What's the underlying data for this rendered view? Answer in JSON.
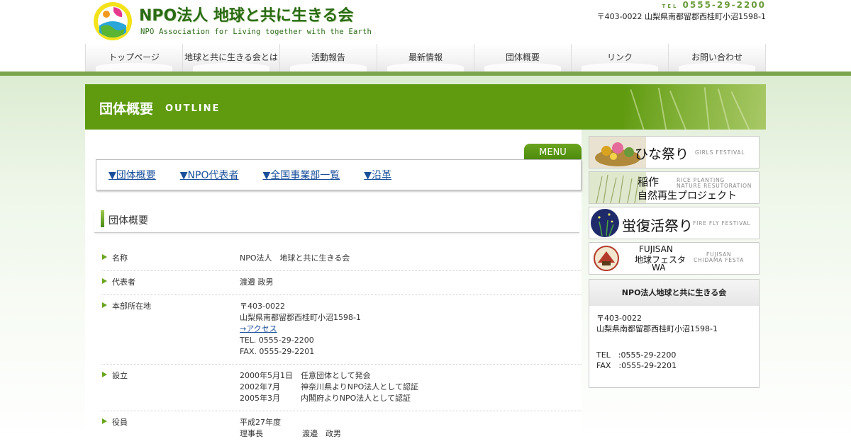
{
  "header": {
    "logo_title": "NPO法人 地球と共に生きる会",
    "logo_sub": "NPO Association for Living together with the Earth",
    "tel_label": "TEL",
    "tel": "0555-29-2200",
    "address": "〒403-0022 山梨県南都留郡西桂町小沼1598-1"
  },
  "nav": {
    "items": [
      "トップページ",
      "地球と共に生きる会とは",
      "活動報告",
      "最新情報",
      "団体概要",
      "リンク",
      "お問い合わせ"
    ]
  },
  "page_title": {
    "jp": "団体概要",
    "en": "OUTLINE"
  },
  "menu": {
    "tab_label": "MENU",
    "links": [
      "▼団体概要",
      "▼NPO代表者",
      "▼全国事業部一覧",
      "▼沿革"
    ]
  },
  "section_title": "団体概要",
  "info": {
    "name_key": "名称",
    "name_val": "NPO法人　地球と共に生きる会",
    "rep_key": "代表者",
    "rep_val": "渡邉 政男",
    "hq_key": "本部所在地",
    "hq_zip": "〒403-0022",
    "hq_addr": "山梨県南都留郡西桂町小沼1598-1",
    "hq_access": "→アクセス",
    "hq_tel": "TEL. 0555-29-2200",
    "hq_fax": "FAX. 0555-29-2201",
    "est_key": "設立",
    "est_1_date": "2000年5月1日",
    "est_1_text": "任意団体として発会",
    "est_2_date": "2002年7月",
    "est_2_text": "神奈川県よりNPO法人として認証",
    "est_3_date": "2005年3月",
    "est_3_text": "内閣府よりNPO法人として認証",
    "officer_key": "役員",
    "officer_year": "平成27年度",
    "officer_role": "理事長",
    "officer_name": "渡邉　政男"
  },
  "side": {
    "banners": [
      {
        "jp": "ひな祭り",
        "en": "GIRLS FESTIVAL"
      },
      {
        "jp": "稲作",
        "jp2": "自然再生プロジェクト",
        "en": "RICE PLANTING",
        "en2": "NATURE RESUTORATION"
      },
      {
        "jp": "蛍復活祭り",
        "en": "FIRE FLY FESTIVAL"
      },
      {
        "jp": "FUJISAN",
        "jp2": "地球フェスタ",
        "jp3": "WA",
        "en": "FUJISAN",
        "en2": "CHIDAMA FESTA"
      }
    ],
    "contact": {
      "title": "NPO法人地球と共に生きる会",
      "zip": "〒403-0022",
      "addr": "山梨県南都留郡西桂町小沼1598-1",
      "tel": "TEL　:0555-29-2200",
      "fax": "FAX　:0555-29-2201"
    }
  },
  "colors": {
    "accent": "#5f9a0f",
    "link": "#1a4f9a",
    "logo": "#2a6a14"
  }
}
